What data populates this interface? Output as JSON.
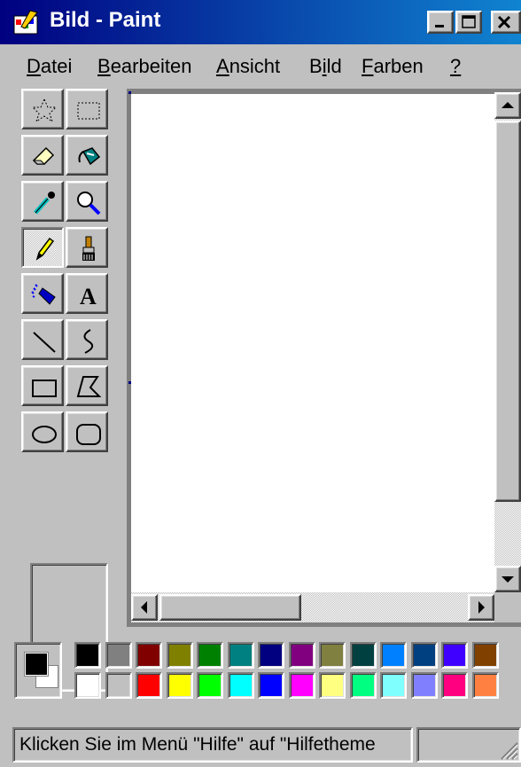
{
  "window": {
    "title": "Bild - Paint",
    "icon": "paint-app-icon",
    "controls": [
      "minimize-icon",
      "maximize-icon",
      "close-icon"
    ]
  },
  "menu": {
    "items": [
      {
        "label": "Datei",
        "underline": "D"
      },
      {
        "label": "Bearbeiten",
        "underline": "B"
      },
      {
        "label": "Ansicht",
        "underline": "A"
      },
      {
        "label": "Bild",
        "underline": "i"
      },
      {
        "label": "Farben",
        "underline": "F"
      },
      {
        "label": "?",
        "underline": "?"
      }
    ]
  },
  "toolbox": {
    "tools": [
      {
        "name": "free-form-select-icon",
        "selected": false
      },
      {
        "name": "rect-select-icon",
        "selected": false
      },
      {
        "name": "eraser-icon",
        "selected": false
      },
      {
        "name": "fill-bucket-icon",
        "selected": false
      },
      {
        "name": "color-picker-icon",
        "selected": false
      },
      {
        "name": "magnifier-icon",
        "selected": false
      },
      {
        "name": "pencil-icon",
        "selected": true
      },
      {
        "name": "brush-icon",
        "selected": false
      },
      {
        "name": "airbrush-icon",
        "selected": false
      },
      {
        "name": "text-icon",
        "selected": false
      },
      {
        "name": "line-icon",
        "selected": false
      },
      {
        "name": "curve-icon",
        "selected": false
      },
      {
        "name": "rectangle-icon",
        "selected": false
      },
      {
        "name": "polygon-icon",
        "selected": false
      },
      {
        "name": "ellipse-icon",
        "selected": false
      },
      {
        "name": "rounded-rect-icon",
        "selected": false
      }
    ],
    "text_tool_glyph": "A"
  },
  "colors": {
    "foreground": "#000000",
    "background": "#ffffff",
    "row1": [
      "#000000",
      "#808080",
      "#800000",
      "#808000",
      "#008000",
      "#008080",
      "#000080",
      "#800080",
      "#808040",
      "#004040",
      "#0080ff",
      "#004080",
      "#4000ff",
      "#804000"
    ],
    "row2": [
      "#ffffff",
      "#c0c0c0",
      "#ff0000",
      "#ffff00",
      "#00ff00",
      "#00ffff",
      "#0000ff",
      "#ff00ff",
      "#ffff80",
      "#00ff80",
      "#80ffff",
      "#8080ff",
      "#ff0080",
      "#ff8040"
    ]
  },
  "status": {
    "text": "Klicken Sie im Menü \"Hilfe\" auf \"Hilfetheme"
  }
}
